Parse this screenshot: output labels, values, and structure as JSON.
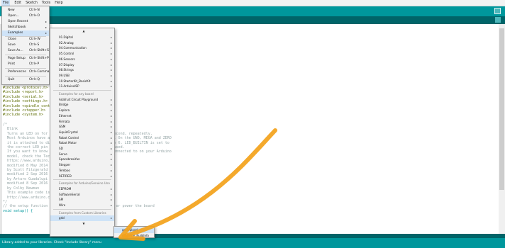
{
  "menubar": [
    "File",
    "Edit",
    "Sketch",
    "Tools",
    "Help"
  ],
  "file_menu": [
    {
      "label": "New",
      "shortcut": "Ctrl+N"
    },
    {
      "label": "Open...",
      "shortcut": "Ctrl+O"
    },
    {
      "label": "Open Recent",
      "shortcut": "",
      "submenu": true
    },
    {
      "label": "Sketchbook",
      "shortcut": "",
      "submenu": true
    },
    {
      "label": "Examples",
      "shortcut": "",
      "submenu": true,
      "highlighted": true
    },
    {
      "label": "Close",
      "shortcut": "Ctrl+W"
    },
    {
      "label": "Save",
      "shortcut": "Ctrl+S"
    },
    {
      "label": "Save As...",
      "shortcut": "Ctrl+Shift+S"
    },
    {
      "label": "Page Setup",
      "shortcut": "Ctrl+Shift+P"
    },
    {
      "label": "Print",
      "shortcut": "Ctrl+P"
    },
    {
      "label": "Preferences",
      "shortcut": "Ctrl+Comma"
    },
    {
      "label": "Quit",
      "shortcut": "Ctrl+Q"
    }
  ],
  "examples_menu": {
    "scroll_up": "▲",
    "scroll_down": "▼",
    "items": [
      {
        "label": "01.Digital",
        "submenu": true
      },
      {
        "label": "02.Analog",
        "submenu": true
      },
      {
        "label": "04.Communication",
        "submenu": true
      },
      {
        "label": "05.Control",
        "submenu": true
      },
      {
        "label": "06.Sensors",
        "submenu": true
      },
      {
        "label": "07.Display",
        "submenu": true
      },
      {
        "label": "08.Strings",
        "submenu": true
      },
      {
        "label": "09.USB",
        "submenu": true
      },
      {
        "label": "10.StarterKit_BasicKit",
        "submenu": true
      },
      {
        "label": "11.ArduinoISP",
        "submenu": true
      },
      {
        "label": "Examples for any board",
        "header": true
      },
      {
        "label": "Adafruit Circuit Playground",
        "submenu": true
      },
      {
        "label": "Bridge",
        "submenu": true
      },
      {
        "label": "Esplora",
        "submenu": true
      },
      {
        "label": "Ethernet",
        "submenu": true
      },
      {
        "label": "Firmata",
        "submenu": true
      },
      {
        "label": "GSM",
        "submenu": true
      },
      {
        "label": "LiquidCrystal",
        "submenu": true
      },
      {
        "label": "Robot Control",
        "submenu": true
      },
      {
        "label": "Robot Motor",
        "submenu": true
      },
      {
        "label": "SD",
        "submenu": true
      },
      {
        "label": "Servo",
        "submenu": true
      },
      {
        "label": "SpacebrewYun",
        "submenu": true
      },
      {
        "label": "Stepper",
        "submenu": true
      },
      {
        "label": "Temboo",
        "submenu": true
      },
      {
        "label": "RETIRED",
        "submenu": true
      },
      {
        "label": "Examples for Arduino/Genuino Uno",
        "header": true
      },
      {
        "label": "EEPROM",
        "submenu": true
      },
      {
        "label": "SoftwareSerial",
        "submenu": true
      },
      {
        "label": "SPI",
        "submenu": true
      },
      {
        "label": "Wire",
        "submenu": true
      },
      {
        "label": "Examples from Custom Libraries",
        "header": true
      },
      {
        "label": "grbl",
        "submenu": true,
        "highlighted": true
      }
    ]
  },
  "grbl_menu": [
    {
      "label": "grblUpload",
      "highlighted": true
    },
    {
      "label": "grblWrite_BuildInfo"
    }
  ],
  "code_includes": [
    "#include <protocol.h>",
    "#include <report.h>",
    "#include <serial.h>",
    "#include <settings.h>",
    "#include <spindle_control.h>",
    "#include <stepper.h>",
    "#include <system.h>"
  ],
  "code_comments": [
    "/*",
    "  Blink",
    "",
    "  Turns an LED on for one second, then off for one second, repeatedly.",
    "",
    "  Most Arduinos have an on-board LED you can control. On the UNO, MEGA and ZERO",
    "  it is attached to digital pin 13, on MKR1000 on pin 6. LED_BUILTIN is set to",
    "  the correct LED pin independent of which board is used.",
    "  If you want to know what pin the on-board LED is connected to on your Arduino",
    "  model, check the Technical Specs of your board at:",
    "  https://www.arduino.cc/en/Main/Products",
    "",
    "  modified 8 May 2014",
    "  by Scott Fitzgerald",
    "  modified 2 Sep 2016",
    "  by Arturo Guadalupi",
    "  modified 8 Sep 2016",
    "  by Colby Newman",
    "",
    "  This example code is in the public domain.",
    "",
    "  http://www.arduino.cc/en/Tutorial/Blink",
    "*/",
    "",
    "// the setup function runs once when you press reset or power the board",
    "void setup() {"
  ],
  "statusbar": {
    "text": "Library added to your libraries. Check \"Include library\" menu"
  },
  "colors": {
    "teal": "#00979c",
    "dark_teal": "#006468",
    "highlight": "#cfe3f7",
    "annotation": "#f3a21a"
  }
}
